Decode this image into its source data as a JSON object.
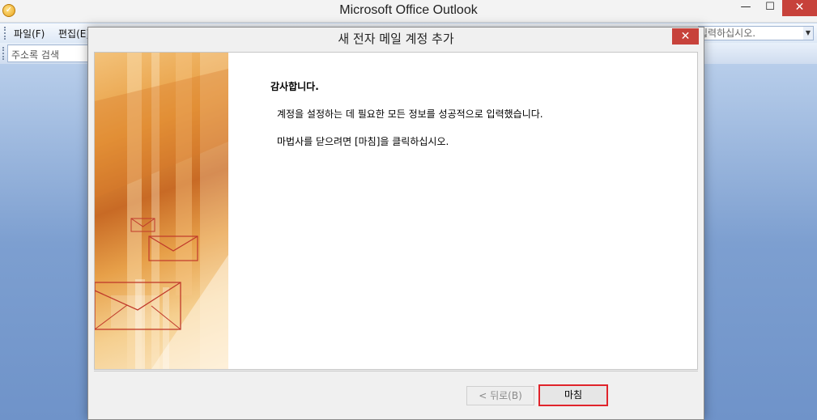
{
  "app": {
    "title": "Microsoft Office Outlook",
    "icon": "outlook-icon",
    "min_glyph": "—",
    "max_glyph": "☐",
    "close_glyph": "✕"
  },
  "menu": {
    "items": [
      "파일(F)",
      "편집(E)"
    ],
    "search_placeholder": "입력하십시오.",
    "search_drop": "▼"
  },
  "toolbar": {
    "address_search": "주소록 검색"
  },
  "dialog": {
    "title": "새 전자 메일 계정 추가",
    "close_glyph": "✕",
    "heading": "감사합니다.",
    "line1": "계정을 설정하는 데 필요한 모든 정보를 성공적으로 입력했습니다.",
    "line2": "마법사를 닫으려면 [마침]을 클릭하십시오.",
    "back_button": "< 뒤로(B)",
    "finish_button": "마침"
  },
  "colors": {
    "close_red": "#c7423b",
    "highlight_red": "#e0242b",
    "envelope_red": "#c0392b"
  }
}
